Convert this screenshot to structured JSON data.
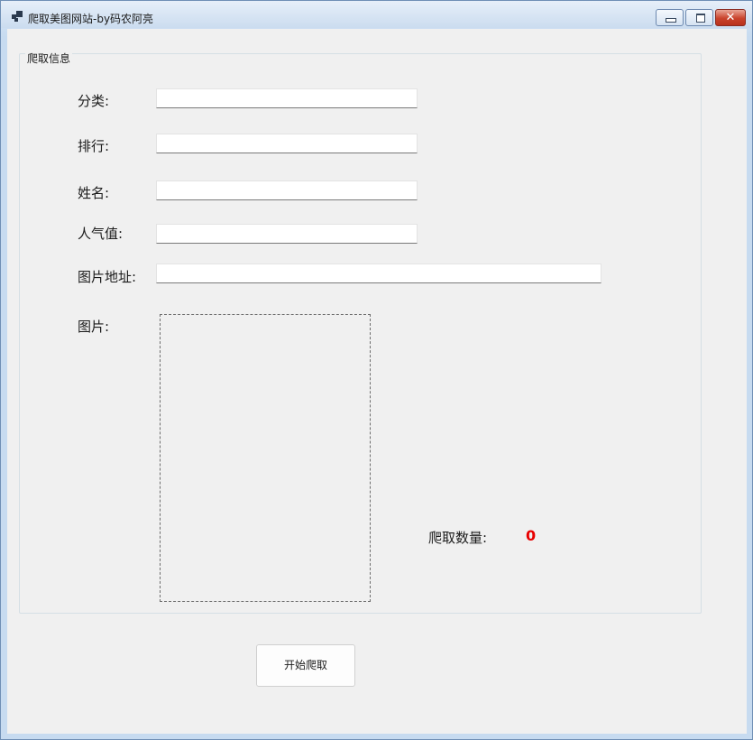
{
  "window": {
    "title": "爬取美图网站-by码农阿亮",
    "close_symbol": "✕"
  },
  "group": {
    "legend": "爬取信息"
  },
  "fields": {
    "category_label": "分类:",
    "category_value": "",
    "rank_label": "排行:",
    "rank_value": "",
    "name_label": "姓名:",
    "name_value": "",
    "popularity_label": "人气值:",
    "popularity_value": "",
    "image_url_label": "图片地址:",
    "image_url_value": "",
    "image_label": "图片:"
  },
  "counter": {
    "label": "爬取数量:",
    "value": "0",
    "value_color": "#e80000"
  },
  "actions": {
    "start_label": "开始爬取"
  }
}
